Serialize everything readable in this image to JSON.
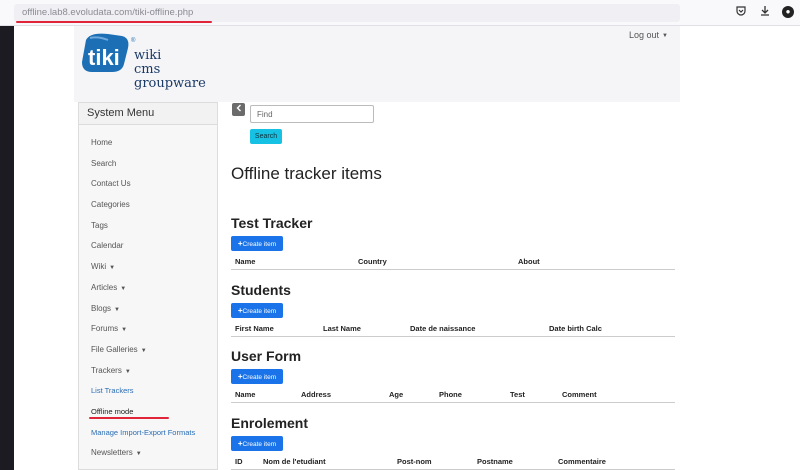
{
  "browser": {
    "url_host": "offline.lab8.evoludata.com",
    "url_path": "/tiki-offline.php",
    "icons": [
      "pocket-icon",
      "download-icon",
      "account-icon"
    ]
  },
  "header": {
    "logo_word": "tiki",
    "logo_line1": "wiki",
    "logo_line2": "cms",
    "logo_line3": "groupware",
    "logout_label": "Log out"
  },
  "sidebar": {
    "title": "System Menu",
    "items": [
      {
        "label": "Home"
      },
      {
        "label": "Search"
      },
      {
        "label": "Contact Us"
      },
      {
        "label": "Categories"
      },
      {
        "label": "Tags"
      },
      {
        "label": "Calendar"
      },
      {
        "label": "Wiki",
        "dropdown": true
      },
      {
        "label": "Articles",
        "dropdown": true
      },
      {
        "label": "Blogs",
        "dropdown": true
      },
      {
        "label": "Forums",
        "dropdown": true
      },
      {
        "label": "File Galleries",
        "dropdown": true
      },
      {
        "label": "Trackers",
        "dropdown": true
      },
      {
        "label": "List Trackers"
      },
      {
        "label": "Offline mode"
      },
      {
        "label": "Manage Import-Export Formats"
      },
      {
        "label": "Newsletters",
        "dropdown": true
      }
    ]
  },
  "search": {
    "placeholder": "Find",
    "button_label": "Search"
  },
  "main": {
    "title": "Offline tracker items",
    "create_label": "Create item",
    "trackers": [
      {
        "name": "Test Tracker",
        "columns": [
          "Name",
          "Country",
          "About"
        ]
      },
      {
        "name": "Students",
        "columns": [
          "First Name",
          "Last Name",
          "Date de naissance",
          "Date birth Calc"
        ]
      },
      {
        "name": "User Form",
        "columns": [
          "Name",
          "Address",
          "Age",
          "Phone",
          "Test",
          "Comment"
        ]
      },
      {
        "name": "Enrolement",
        "columns": [
          "ID",
          "Nom de l'etudiant",
          "Post-nom",
          "Postname",
          "Commentaire"
        ]
      }
    ]
  },
  "colors": {
    "create_button": "#1a73e8",
    "search_button": "#17c1e4",
    "annotation_underline": "#e0243a",
    "logo_blue": "#1c6fb5"
  }
}
